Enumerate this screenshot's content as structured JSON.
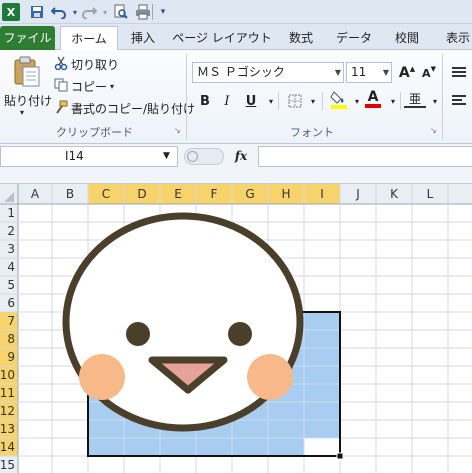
{
  "qat": {
    "icons": [
      "excel-icon",
      "save-icon",
      "undo-icon",
      "redo-icon",
      "print-preview-icon",
      "print-icon",
      "customize-icon"
    ]
  },
  "tabs": [
    {
      "label": "ファイル"
    },
    {
      "label": "ホーム"
    },
    {
      "label": "挿入"
    },
    {
      "label": "ページ レイアウト"
    },
    {
      "label": "数式"
    },
    {
      "label": "データ"
    },
    {
      "label": "校閲"
    },
    {
      "label": "表示"
    }
  ],
  "clipboard": {
    "paste": "貼り付け",
    "cut": "切り取り",
    "copy": "コピー",
    "format_painter": "書式のコピー/貼り付け",
    "group_label": "クリップボード"
  },
  "font": {
    "name": "ＭＳ Ｐゴシック",
    "size": "11",
    "group_label": "フォント",
    "bold": "B",
    "italic": "I",
    "underline": "U",
    "grow": "A",
    "shrink": "A",
    "phonetic": "亜",
    "font_color_letter": "A"
  },
  "formula_bar": {
    "name_box": "I14",
    "fx": "fx",
    "formula": ""
  },
  "grid": {
    "columns": [
      "A",
      "B",
      "C",
      "D",
      "E",
      "F",
      "G",
      "H",
      "I",
      "J",
      "K",
      "L"
    ],
    "rows": [
      "1",
      "2",
      "3",
      "4",
      "5",
      "6",
      "7",
      "8",
      "9",
      "10",
      "11",
      "12",
      "13",
      "14",
      "15"
    ],
    "selected_columns": [
      "C",
      "D",
      "E",
      "F",
      "G",
      "H",
      "I"
    ],
    "selected_rows": [
      "7",
      "8",
      "9",
      "10",
      "11",
      "12",
      "13",
      "14"
    ],
    "active_cell": "I14"
  },
  "colors": {
    "accent_green": "#2f7d32",
    "selection_fill": "#a9cdf0",
    "header_highlight": "#f7d46b",
    "face_outline": "#4a3f2a",
    "cheek": "#f7b98a",
    "mouth": "#e8a29c"
  }
}
